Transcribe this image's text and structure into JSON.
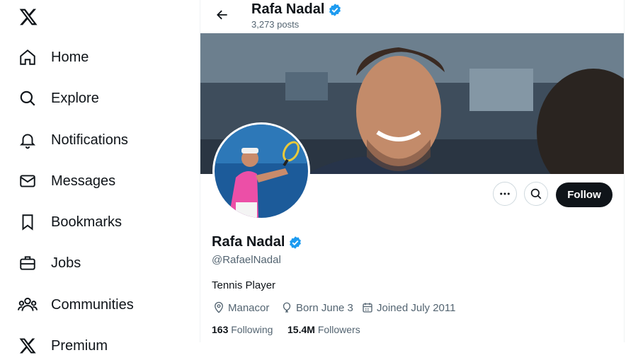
{
  "nav": {
    "items": [
      {
        "label": "Home",
        "icon": "home-icon"
      },
      {
        "label": "Explore",
        "icon": "search-icon"
      },
      {
        "label": "Notifications",
        "icon": "bell-icon"
      },
      {
        "label": "Messages",
        "icon": "envelope-icon"
      },
      {
        "label": "Bookmarks",
        "icon": "bookmark-icon"
      },
      {
        "label": "Jobs",
        "icon": "briefcase-icon"
      },
      {
        "label": "Communities",
        "icon": "people-icon"
      },
      {
        "label": "Premium",
        "icon": "x-logo-icon"
      }
    ]
  },
  "header": {
    "name": "Rafa Nadal",
    "posts": "3,273 posts"
  },
  "profile": {
    "name": "Rafa Nadal",
    "handle": "@RafaelNadal",
    "bio": "Tennis Player",
    "location": "Manacor",
    "born": "Born June 3",
    "joined": "Joined July 2011",
    "following_count": "163",
    "following_label": "Following",
    "followers_count": "15.4M",
    "followers_label": "Followers",
    "follow_button": "Follow"
  },
  "colors": {
    "accent": "#1d9bf0",
    "text": "#0f1419",
    "secondary": "#536471",
    "follow_bg": "#0f1419"
  }
}
